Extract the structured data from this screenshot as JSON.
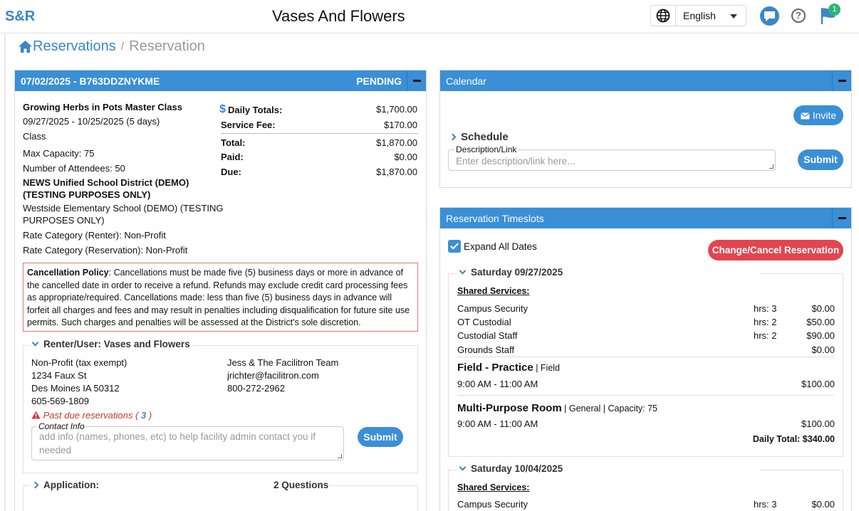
{
  "header": {
    "logo": "S&R",
    "title": "Vases And Flowers",
    "language": "English",
    "notification_count": "1"
  },
  "breadcrumb": {
    "home": "Reservations",
    "separator": "/",
    "current": "Reservation"
  },
  "reservation": {
    "id": "07/02/2025 - B763DDZNYKME",
    "status": "PENDING",
    "event_name": "Growing Herbs in Pots Master Class",
    "date_range": "09/27/2025 - 10/25/2025 (5 days)",
    "type": "Class",
    "max_capacity": "Max Capacity: 75",
    "attendees": "Number of Attendees: 50",
    "district_line1": "NEWS Unified School District (DEMO)",
    "district_line2": "(TESTING PURPOSES ONLY)",
    "school_line1": "Westside Elementary School (DEMO) (TESTING",
    "school_line2": "PURPOSES ONLY)",
    "rate_renter": "Rate Category (Renter): Non-Profit",
    "rate_reservation": "Rate Category (Reservation): Non-Profit",
    "totals": {
      "daily_label": "Daily Totals:",
      "daily_value": "$1,700.00",
      "service_label": "Service Fee:",
      "service_value": "$170.00",
      "total_label": "Total:",
      "total_value": "$1,870.00",
      "paid_label": "Paid:",
      "paid_value": "$0.00",
      "due_label": "Due:",
      "due_value": "$1,870.00"
    },
    "policy_title": "Cancellation Policy",
    "policy_text": ": Cancellations must be made five (5) business days or more in advance of the cancelled date in order to receive a refund. Refunds may exclude credit card processing fees as appropriate/required. Cancellations made: less than five (5) business days in advance will forfeit all charges and fees and may result in penalties including disqualification for future site use permits. Such charges and penalties will be assessed at the District's sole discretion."
  },
  "renter": {
    "title": "Renter/User: Vases and Flowers",
    "org_type": "Non-Profit (tax exempt)",
    "address1": "1234 Faux St",
    "address2": "Des Moines IA 50312",
    "phone": "605-569-1809",
    "contact_name": "Jess & The Facilitron Team",
    "contact_email": "jrichter@facilitron.com",
    "contact_phone": "800-272-2962",
    "past_due_label": "Past due reservations",
    "past_due_count": "3",
    "contact_info_label": "Contact Info",
    "contact_placeholder": "add info (names, phones, etc) to help facility admin contact you if needed",
    "submit": "Submit"
  },
  "application": {
    "title": "Application:",
    "questions": "2 Questions"
  },
  "calendar": {
    "title": "Calendar",
    "invite": "Invite",
    "schedule": "Schedule",
    "desc_label": "Description/Link",
    "desc_placeholder": "Enter description/link here...",
    "submit": "Submit"
  },
  "timeslots": {
    "title": "Reservation Timeslots",
    "expand_all": "Expand All Dates",
    "change_cancel": "Change/Cancel Reservation",
    "day1": {
      "date": "Saturday 09/27/2025",
      "shared_label": "Shared Services:",
      "services": [
        {
          "name": "Campus Security",
          "hrs": "hrs: 3",
          "price": "$0.00"
        },
        {
          "name": "OT Custodial",
          "hrs": "hrs: 2",
          "price": "$50.00"
        },
        {
          "name": "Custodial Staff",
          "hrs": "hrs: 2",
          "price": "$90.00"
        },
        {
          "name": "Grounds Staff",
          "hrs": "",
          "price": "$0.00"
        }
      ],
      "room1_name": "Field - Practice",
      "room1_meta": " | Field",
      "room1_time": "9:00 AM - 11:00 AM",
      "room1_price": "$100.00",
      "room2_name": "Multi-Purpose Room",
      "room2_meta": " | General | Capacity: 75",
      "room2_time": "9:00 AM - 11:00 AM",
      "room2_price": "$100.00",
      "daily_total": "Daily Total: $340.00"
    },
    "day2": {
      "date": "Saturday 10/04/2025",
      "shared_label": "Shared Services:",
      "services": [
        {
          "name": "Campus Security",
          "hrs": "hrs: 3",
          "price": "$0.00"
        }
      ]
    }
  }
}
